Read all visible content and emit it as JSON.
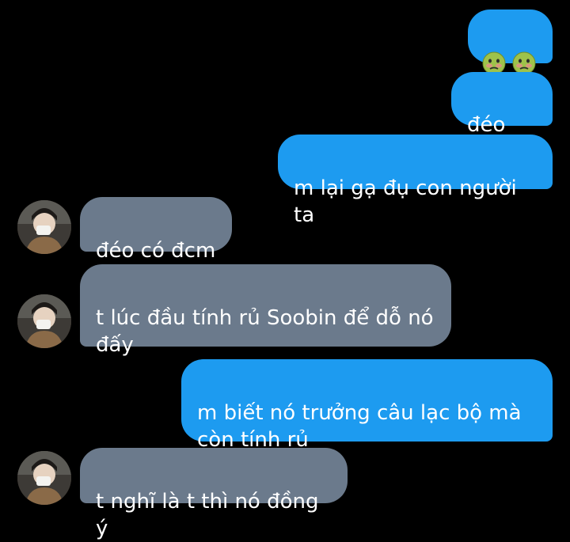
{
  "messages": [
    {
      "id": "m1",
      "direction": "sent",
      "type": "emoji",
      "emoji_icons": [
        "nauseated-face-icon",
        "nauseated-face-icon"
      ]
    },
    {
      "id": "m2",
      "direction": "sent",
      "text": "đéo tin"
    },
    {
      "id": "m3",
      "direction": "sent",
      "text": "m lại gạ đụ con người ta"
    },
    {
      "id": "m4",
      "direction": "received",
      "text": "đéo có đcm"
    },
    {
      "id": "m5",
      "direction": "received",
      "text": "t lúc đầu tính rủ Soobin để dỗ nó\nđấy"
    },
    {
      "id": "m6",
      "direction": "sent",
      "text": "m biết nó trưởng câu lạc bộ mà\ncòn tính rủ"
    },
    {
      "id": "m7",
      "direction": "received",
      "text": "t nghĩ là t thì nó đồng ý"
    }
  ],
  "colors": {
    "background": "#000000",
    "sent_bubble": "#1d9bf0",
    "received_bubble": "#6b7a8c",
    "text": "#ffffff"
  }
}
